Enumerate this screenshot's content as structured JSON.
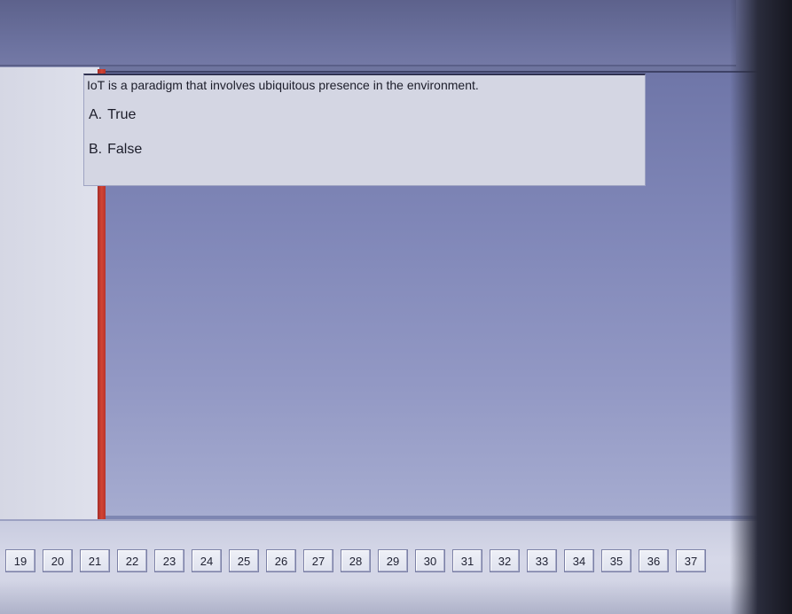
{
  "question": {
    "text": "IoT is a paradigm that involves ubiquitous presence in the environment.",
    "options": [
      {
        "letter": "A.",
        "label": "True"
      },
      {
        "letter": "B.",
        "label": "False"
      }
    ]
  },
  "question_nav": [
    "19",
    "20",
    "21",
    "22",
    "23",
    "24",
    "25",
    "26",
    "27",
    "28",
    "29",
    "30",
    "31",
    "32",
    "33",
    "34",
    "35",
    "36",
    "37"
  ],
  "colors": {
    "divider": "#d24434",
    "panel_bg": "#d4d6e3",
    "main_bg": "#8087b8"
  }
}
